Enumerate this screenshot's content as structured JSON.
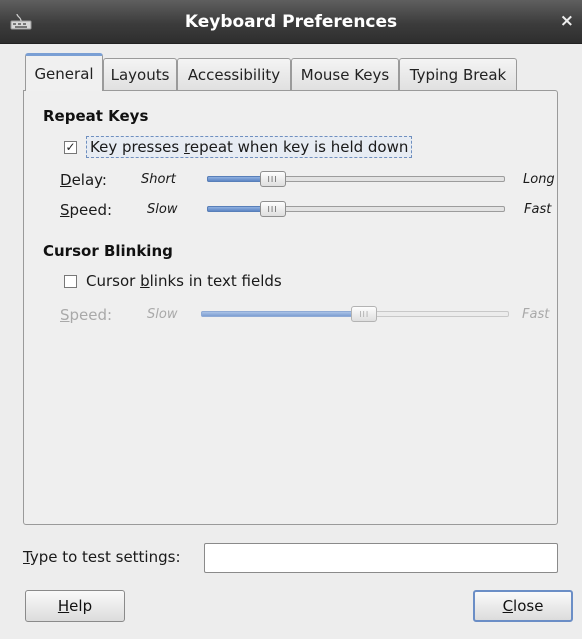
{
  "window": {
    "title": "Keyboard Preferences",
    "close_glyph": "×",
    "icon": "keyboard-icon"
  },
  "tabs": [
    {
      "label": "General",
      "active": true
    },
    {
      "label": "Layouts",
      "active": false
    },
    {
      "label": "Accessibility",
      "active": false
    },
    {
      "label": "Mouse Keys",
      "active": false
    },
    {
      "label": "Typing Break",
      "active": false
    }
  ],
  "repeat_keys": {
    "title": "Repeat Keys",
    "checkbox_checked": true,
    "checkbox_glyph": "✓",
    "checkbox_label": {
      "before": "Key presses ",
      "mnemonic": "r",
      "after": "epeat when key is held down"
    },
    "delay": {
      "label_mnemonic": "D",
      "label_rest": "elay:",
      "min_label": "Short",
      "max_label": "Long",
      "value_fraction": 0.22
    },
    "speed": {
      "label_mnemonic": "S",
      "label_rest": "peed:",
      "min_label": "Slow",
      "max_label": "Fast",
      "value_fraction": 0.22
    }
  },
  "cursor_blinking": {
    "title": "Cursor Blinking",
    "checkbox_checked": false,
    "checkbox_label": {
      "before": "Cursor ",
      "mnemonic": "b",
      "after": "links in text fields"
    },
    "speed": {
      "label_mnemonic": "S",
      "label_rest": "peed:",
      "min_label": "Slow",
      "max_label": "Fast",
      "value_fraction": 0.53
    }
  },
  "test": {
    "label_mnemonic": "T",
    "label_rest": "ype to test settings:",
    "value": ""
  },
  "buttons": {
    "help": {
      "mnemonic": "H",
      "rest": "elp"
    },
    "close": {
      "mnemonic": "C",
      "rest": "lose"
    }
  },
  "colors": {
    "accent": "#7a9fd4",
    "titlebar": "#3c3c3c"
  }
}
